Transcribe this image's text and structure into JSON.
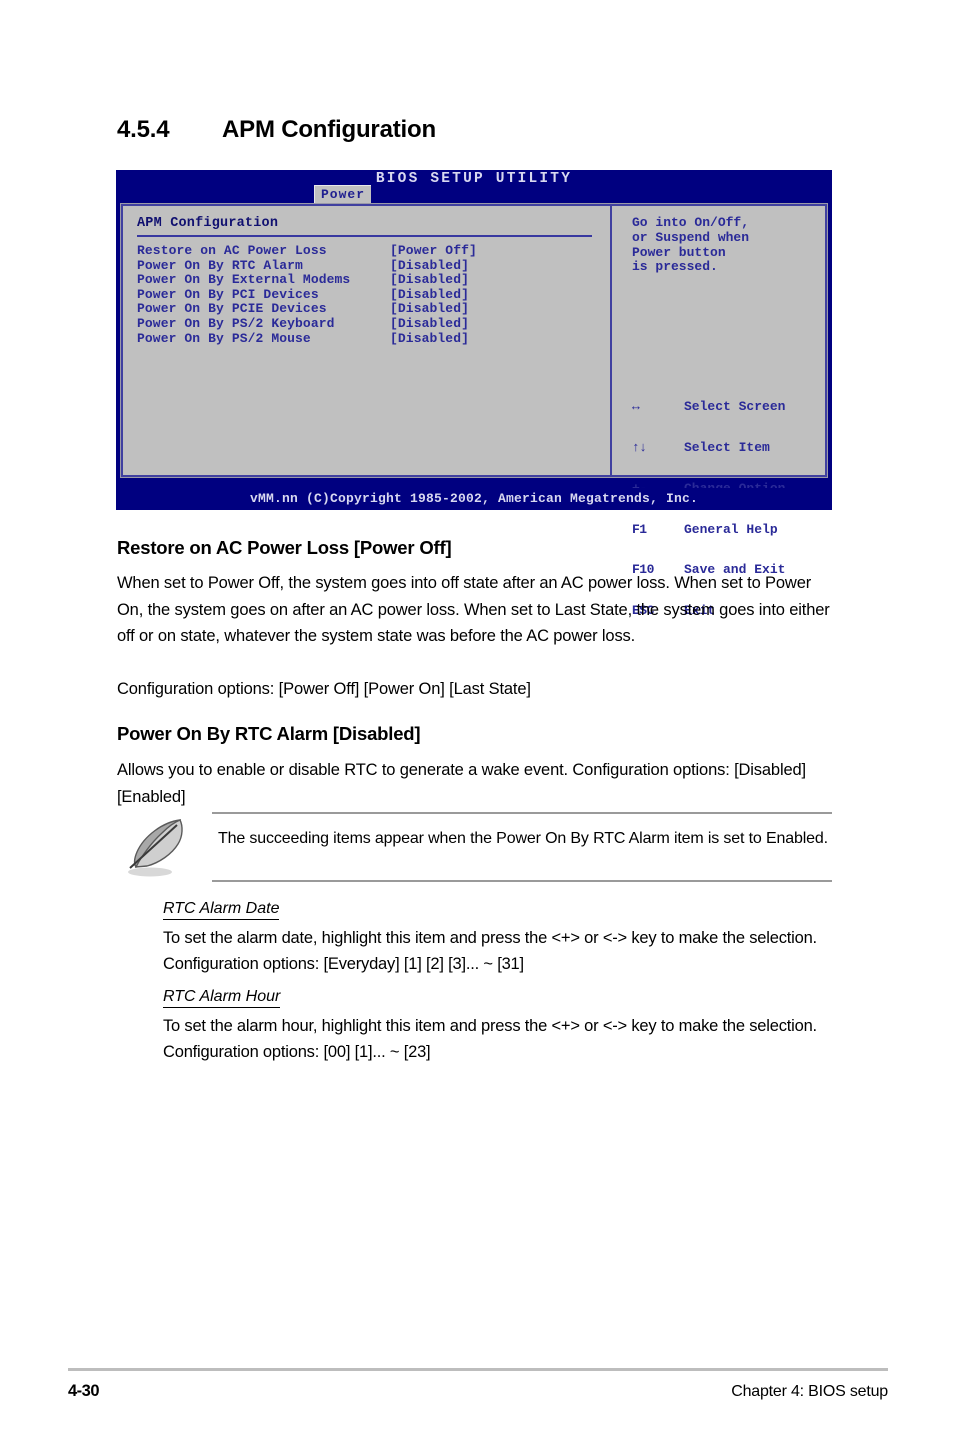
{
  "document": {
    "section_number": "4.5.4",
    "section_title": "APM Configuration"
  },
  "bios": {
    "title": "BIOS SETUP UTILITY",
    "active_tab": "Power",
    "panel_header": "APM Configuration",
    "items": [
      {
        "label": "Restore on AC Power Loss",
        "value": "[Power Off]"
      },
      {
        "label": "Power On By RTC Alarm",
        "value": "[Disabled]"
      },
      {
        "label": "Power On By External Modems",
        "value": "[Disabled]"
      },
      {
        "label": "Power On By PCI Devices",
        "value": "[Disabled]"
      },
      {
        "label": "Power On By PCIE Devices",
        "value": "[Disabled]"
      },
      {
        "label": "Power On By PS/2 Keyboard",
        "value": "[Disabled]"
      },
      {
        "label": "Power On By PS/2 Mouse",
        "value": "[Disabled]"
      }
    ],
    "help_text": "Go into On/Off,\nor Suspend when\nPower button\nis pressed.",
    "legend": [
      {
        "key": "↔",
        "action": "Select Screen"
      },
      {
        "key": "↑↓",
        "action": "Select Item"
      },
      {
        "key": "+-",
        "action": "Change Option"
      },
      {
        "key": "F1",
        "action": "General Help"
      },
      {
        "key": "F10",
        "action": "Save and Exit"
      },
      {
        "key": "ESC",
        "action": "Exit"
      }
    ],
    "footer": "vMM.nn (C)Copyright 1985-2002, American Megatrends, Inc.",
    "colors": {
      "titlebar": "#000080",
      "panel": "#c0c0c0",
      "text": "#2a2a98",
      "rule": "#3838a0"
    }
  },
  "sections": [
    {
      "heading": "Restore on AC Power Loss [Power Off]",
      "body": "When set to Power Off, the system goes into off state after an AC power loss. When set to Power On, the system goes on after an AC power loss. When set to Last State, the system goes into either off or on state, whatever the system state was before the AC power loss.",
      "options_line": "Configuration options: [Power Off] [Power On] [Last State]"
    },
    {
      "heading": "Power On By RTC Alarm [Disabled]",
      "body": "Allows you to enable or disable RTC to generate a wake event. Configuration options: [Disabled] [Enabled]"
    }
  ],
  "note": {
    "icon": "quill-icon",
    "text": "The succeeding items appear when the Power On By RTC Alarm item is set to Enabled."
  },
  "sub_sections": [
    {
      "title": "RTC Alarm Date ",
      "body": "To set the alarm date, highlight this item and press the <+> or <-> key to make the selection. Configuration options: [Everyday] [1] [2] [3]... ~ [31]"
    },
    {
      "title": "RTC Alarm Hour",
      "body": "To set the alarm hour, highlight this item and press the <+> or <-> key to make the selection. Configuration options: [00] [1]... ~ [23]"
    }
  ],
  "page_footer": {
    "page_number": "4-30",
    "chapter": "Chapter 4: BIOS setup"
  }
}
